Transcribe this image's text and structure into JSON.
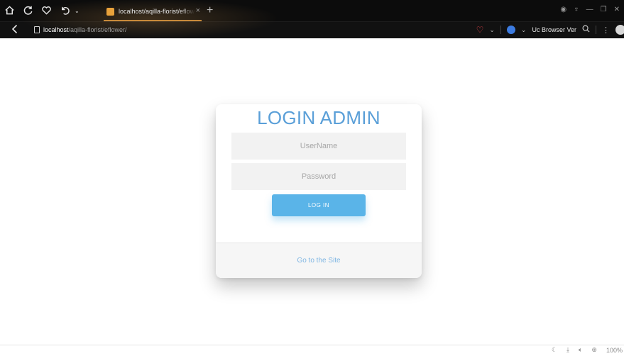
{
  "browser": {
    "tab_title": "localhost/aqilla-florist/eflower/",
    "tab_close": "×",
    "new_tab": "+",
    "url_host": "localhost",
    "url_path": "/aqilla-florist/eflower/",
    "browser_name": "Uc Browser Ver",
    "icons": [
      "home-icon",
      "reload-icon",
      "heart-icon",
      "undo-icon",
      "back-icon",
      "search-icon",
      "menu-icon"
    ]
  },
  "login": {
    "title": "LOGIN ADMIN",
    "username_placeholder": "UserName",
    "password_placeholder": "Password",
    "button_label": "LOG IN",
    "footer_link": "Go to the Site"
  },
  "statusbar": {
    "zoom": "100%"
  },
  "colors": {
    "accent": "#5ab4e8",
    "title": "#5a9fd8",
    "chrome": "#0c0c0c"
  }
}
